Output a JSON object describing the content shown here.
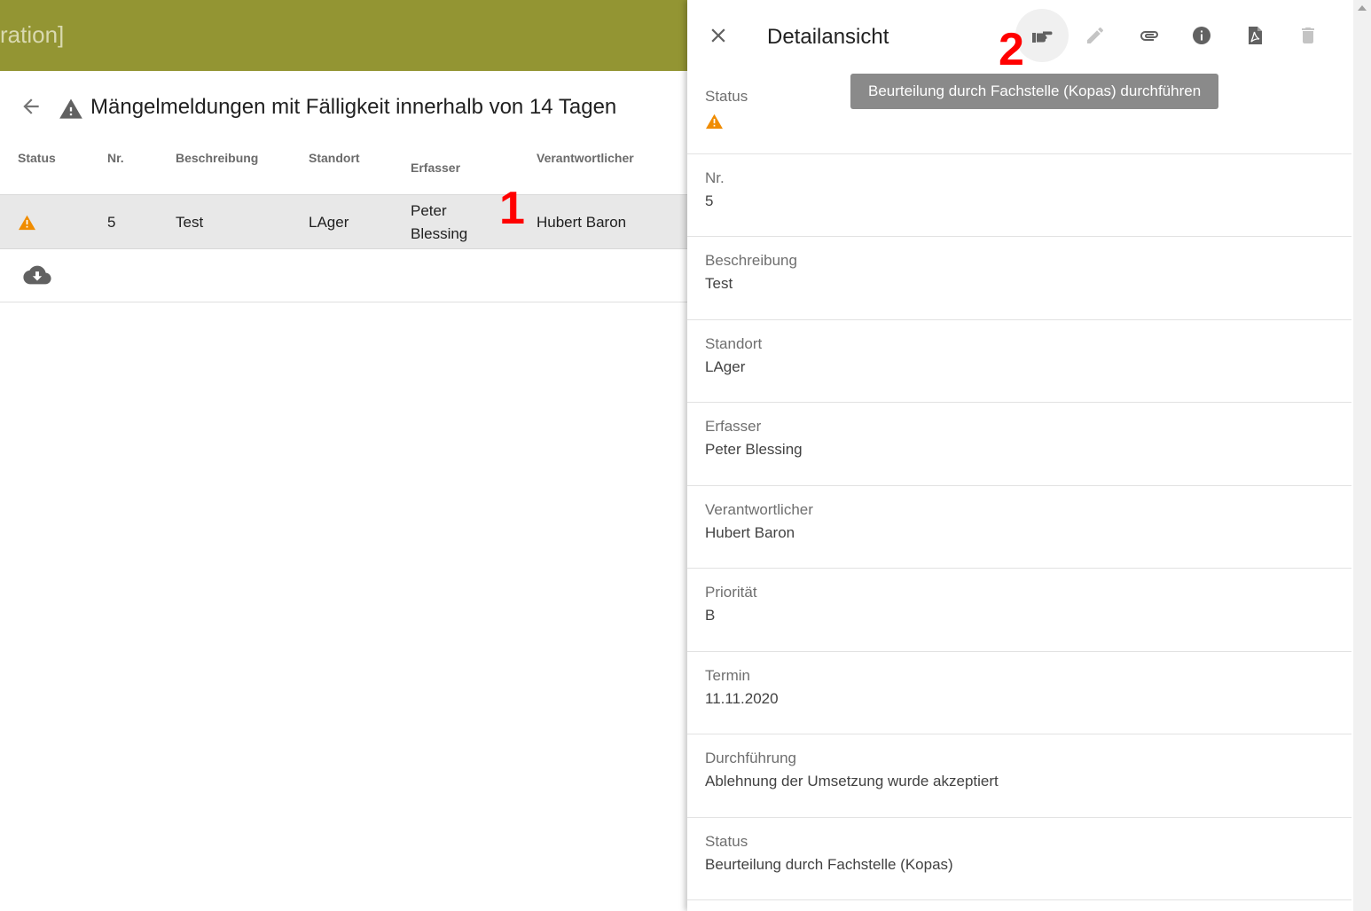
{
  "app": {
    "title_fragment": "ration]"
  },
  "list": {
    "title": "Mängelmeldungen mit Fälligkeit innerhalb von 14 Tagen",
    "columns": [
      "Status",
      "Nr.",
      "Beschreibung",
      "Standort",
      "Erfasser",
      "Verantwortlicher"
    ],
    "rows": [
      {
        "status_icon": "warning-icon",
        "nr": "5",
        "beschreibung": "Test",
        "standort": "LAger",
        "erfasser_line1": "Peter",
        "erfasser_line2": "Blessing",
        "verantwortlicher": "Hubert Baron"
      }
    ]
  },
  "annotations": {
    "one": "1",
    "two": "2"
  },
  "detail": {
    "title": "Detailansicht",
    "tooltip": "Beurteilung durch Fachstelle (Kopas) durchführen",
    "toolbar_icons": [
      "thumb-point-icon",
      "edit-icon",
      "attachment-icon",
      "info-icon",
      "pdf-icon",
      "delete-icon"
    ],
    "fields": [
      {
        "label": "Status",
        "value": ""
      },
      {
        "label": "Nr.",
        "value": "5"
      },
      {
        "label": "Beschreibung",
        "value": "Test"
      },
      {
        "label": "Standort",
        "value": "LAger"
      },
      {
        "label": "Erfasser",
        "value": "Peter Blessing"
      },
      {
        "label": "Verantwortlicher",
        "value": "Hubert Baron"
      },
      {
        "label": "Priorität",
        "value": "B"
      },
      {
        "label": "Termin",
        "value": "11.11.2020"
      },
      {
        "label": "Durchführung",
        "value": "Ablehnung der Umsetzung wurde akzeptiert"
      },
      {
        "label": "Status",
        "value": "Beurteilung durch Fachstelle (Kopas)"
      }
    ]
  },
  "colors": {
    "topbar": "#939533",
    "warning": "#f08c00",
    "icon_grey": "#757575",
    "icon_disabled": "#c4c4c4",
    "tooltip_bg": "#8a8a8a",
    "annotation": "#ff0000"
  }
}
